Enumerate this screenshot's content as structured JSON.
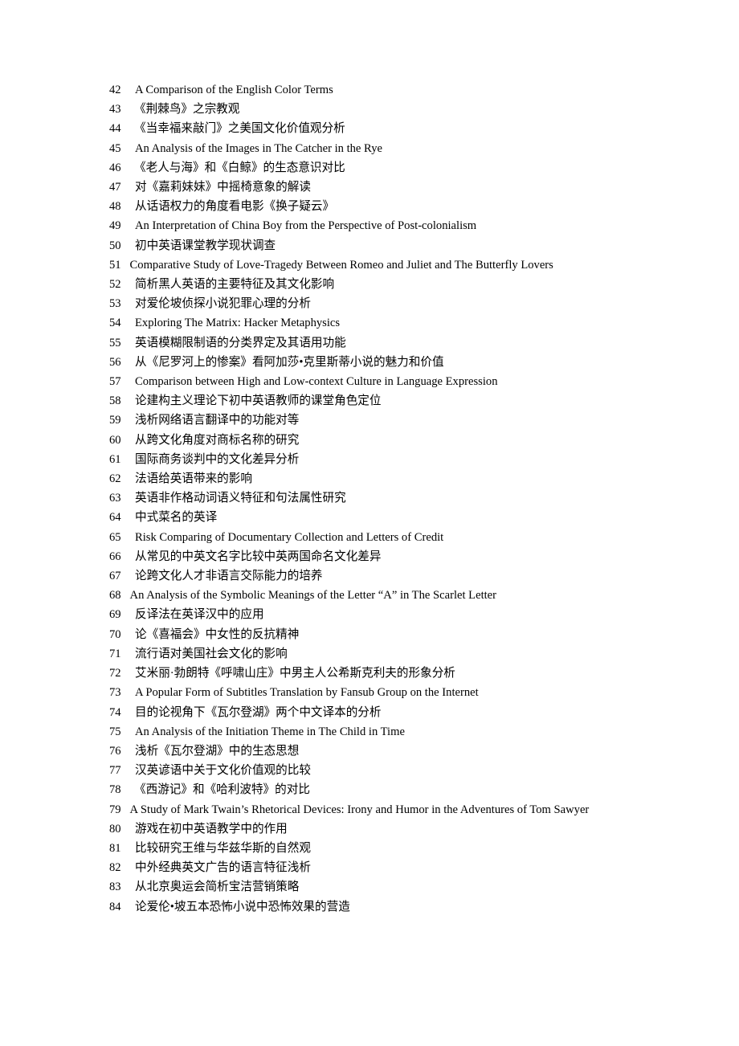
{
  "document": {
    "type": "numbered-title-list",
    "entries": [
      {
        "number": "42",
        "title": "A Comparison of the English Color Terms"
      },
      {
        "number": "43",
        "title": "《荆棘鸟》之宗教观"
      },
      {
        "number": "44",
        "title": "《当幸福来敲门》之美国文化价值观分析"
      },
      {
        "number": "45",
        "title": "An Analysis of the Images in The Catcher in the Rye"
      },
      {
        "number": "46",
        "title": "《老人与海》和《白鲸》的生态意识对比"
      },
      {
        "number": "47",
        "title": "对《嘉莉妹妹》中摇椅意象的解读"
      },
      {
        "number": "48",
        "title": "从话语权力的角度看电影《换子疑云》"
      },
      {
        "number": "49",
        "title": "An Interpretation of China Boy from the Perspective of Post-colonialism"
      },
      {
        "number": "50",
        "title": "初中英语课堂教学现状调查"
      },
      {
        "number": "51",
        "title": "Comparative Study of Love-Tragedy Between Romeo and Juliet and The Butterfly Lovers"
      },
      {
        "number": "52",
        "title": "简析黑人英语的主要特征及其文化影响"
      },
      {
        "number": "53",
        "title": "对爱伦坡侦探小说犯罪心理的分析"
      },
      {
        "number": "54",
        "title": "Exploring The Matrix: Hacker Metaphysics"
      },
      {
        "number": "55",
        "title": "英语模糊限制语的分类界定及其语用功能"
      },
      {
        "number": "56",
        "title": "从《尼罗河上的惨案》看阿加莎•克里斯蒂小说的魅力和价值"
      },
      {
        "number": "57",
        "title": "Comparison between High and Low-context Culture in Language Expression"
      },
      {
        "number": "58",
        "title": "论建构主义理论下初中英语教师的课堂角色定位"
      },
      {
        "number": "59",
        "title": "浅析网络语言翻译中的功能对等"
      },
      {
        "number": "60",
        "title": "从跨文化角度对商标名称的研究"
      },
      {
        "number": "61",
        "title": "国际商务谈判中的文化差异分析"
      },
      {
        "number": "62",
        "title": "法语给英语带来的影响"
      },
      {
        "number": "63",
        "title": "英语非作格动词语义特征和句法属性研究"
      },
      {
        "number": "64",
        "title": "中式菜名的英译"
      },
      {
        "number": "65",
        "title": "Risk Comparing of Documentary Collection and Letters of Credit"
      },
      {
        "number": "66",
        "title": "从常见的中英文名字比较中英两国命名文化差异"
      },
      {
        "number": "67",
        "title": "论跨文化人才非语言交际能力的培养"
      },
      {
        "number": "68",
        "title": "An Analysis of the Symbolic Meanings of the Letter “A” in The Scarlet Letter"
      },
      {
        "number": "69",
        "title": "反译法在英译汉中的应用"
      },
      {
        "number": "70",
        "title": "论《喜福会》中女性的反抗精神"
      },
      {
        "number": "71",
        "title": "流行语对美国社会文化的影响"
      },
      {
        "number": "72",
        "title": "艾米丽·勃朗特《呼啸山庄》中男主人公希斯克利夫的形象分析"
      },
      {
        "number": "73",
        "title": "A Popular Form of Subtitles Translation by Fansub Group on the Internet"
      },
      {
        "number": "74",
        "title": "目的论视角下《瓦尔登湖》两个中文译本的分析"
      },
      {
        "number": "75",
        "title": "An Analysis of the Initiation Theme in The Child in Time"
      },
      {
        "number": "76",
        "title": "浅析《瓦尔登湖》中的生态思想"
      },
      {
        "number": "77",
        "title": "汉英谚语中关于文化价值观的比较"
      },
      {
        "number": "78",
        "title": "《西游记》和《哈利波特》的对比"
      },
      {
        "number": "79",
        "title": "A Study of Mark Twain’s Rhetorical Devices: Irony and Humor in the Adventures of Tom Sawyer"
      },
      {
        "number": "80",
        "title": "游戏在初中英语教学中的作用"
      },
      {
        "number": "81",
        "title": "比较研究王维与华兹华斯的自然观"
      },
      {
        "number": "82",
        "title": "中外经典英文广告的语言特征浅析"
      },
      {
        "number": "83",
        "title": "从北京奥运会简析宝洁营销策略"
      },
      {
        "number": "84",
        "title": "论爱伦•坡五本恐怖小说中恐怖效果的营造"
      }
    ]
  }
}
